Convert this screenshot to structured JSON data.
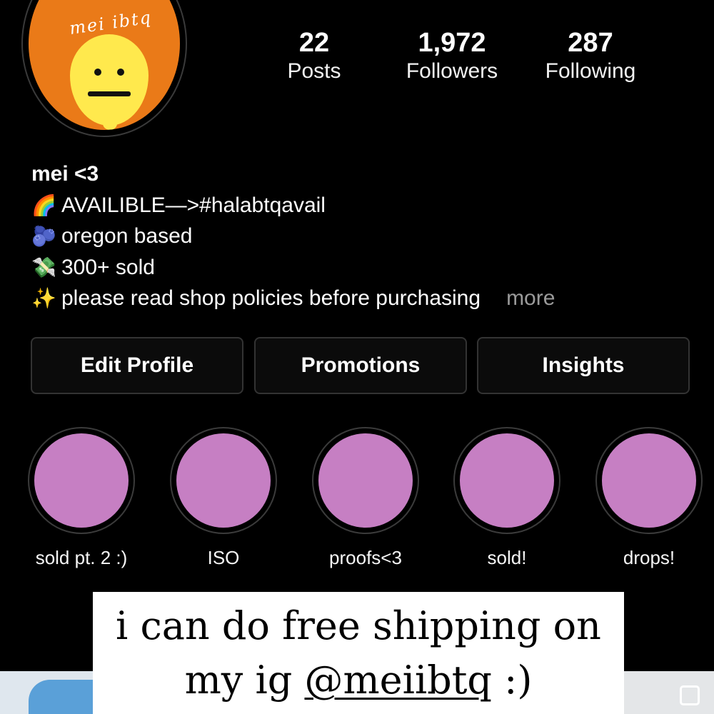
{
  "profile": {
    "avatar_text": "mei ibtq",
    "stats": [
      {
        "value": "22",
        "label": "Posts"
      },
      {
        "value": "1,972",
        "label": "Followers"
      },
      {
        "value": "287",
        "label": "Following"
      }
    ],
    "name": "mei <3",
    "bio": [
      {
        "icon": "rainbow-icon",
        "glyph": "🌈",
        "text": "AVAILIBLE—>#halabtqavail"
      },
      {
        "icon": "blueberries-icon",
        "glyph": "🫐",
        "text": "oregon based"
      },
      {
        "icon": "money-icon",
        "glyph": "💸",
        "text": "300+ sold"
      },
      {
        "icon": "sparkles-icon",
        "glyph": "✨",
        "text": "please read shop policies before purchasing"
      }
    ],
    "more_label": "more"
  },
  "buttons": {
    "edit_profile": "Edit Profile",
    "promotions": "Promotions",
    "insights": "Insights"
  },
  "highlights": [
    {
      "label": "sold pt. 2 :)"
    },
    {
      "label": "ISO"
    },
    {
      "label": "proofs<3"
    },
    {
      "label": "sold!"
    },
    {
      "label": "drops!"
    }
  ],
  "overlay": {
    "line1": "i can do free shipping on",
    "line2_prefix": "my ig ",
    "handle": "@meiibtq",
    "line2_suffix": " :)"
  },
  "colors": {
    "background": "#000000",
    "avatar_bg": "#ea7a18",
    "lemon": "#ffe94d",
    "highlight_cover": "#c67fc3"
  }
}
